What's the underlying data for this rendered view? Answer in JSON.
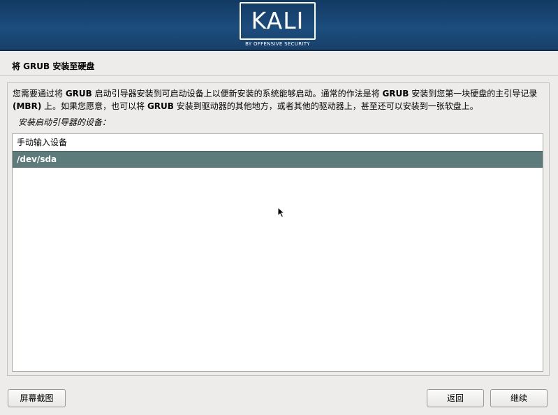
{
  "banner": {
    "logo_text": "KALI",
    "logo_sub": "BY OFFENSIVE SECURITY",
    "bg_color": "#1c4d7d"
  },
  "page_title": "将 GRUB 安装至硬盘",
  "description": {
    "line1_a": "您需要通过将 ",
    "line1_b": "GRUB",
    "line1_c": " 启动引导器安装到可启动设备上以便新安装的系统能够启动。通常的作法是将 ",
    "line1_d": "GRUB",
    "line1_e": " 安装到您第一块硬盘的主引导记录",
    "line2_a": "(MBR)",
    "line2_b": " 上。如果您愿意，也可以将 ",
    "line2_c": "GRUB",
    "line2_d": " 安装到驱动器的其他地方，或者其他的驱动器上，甚至还可以安装到一张软盘上。"
  },
  "prompt": "安装启动引导器的设备：",
  "device_list": {
    "items": [
      {
        "label": "手动输入设备",
        "selected": false
      },
      {
        "label": "/dev/sda",
        "selected": true
      }
    ],
    "selected_color": "#5d7b7b"
  },
  "buttons": {
    "screenshot": "屏幕截图",
    "back": "返回",
    "continue": "继续"
  }
}
